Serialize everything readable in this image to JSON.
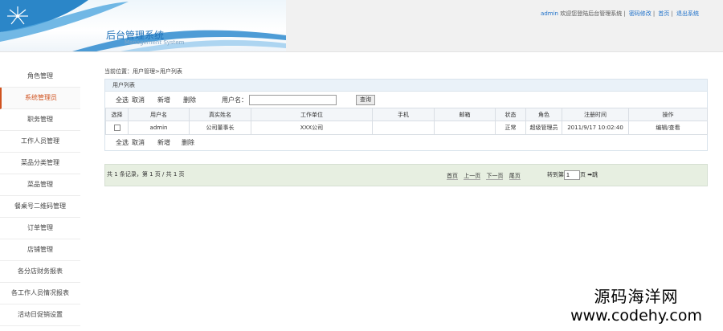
{
  "header": {
    "app_title": "后台管理系统",
    "app_subtitle": "Management System",
    "user": "admin",
    "welcome": "欢迎您登陆后台管理系统",
    "links": [
      "密码修改",
      "首页",
      "退出系统"
    ]
  },
  "sidebar": {
    "items": [
      {
        "label": "角色管理"
      },
      {
        "label": "系统管理员"
      },
      {
        "label": "职务管理"
      },
      {
        "label": "工作人员管理"
      },
      {
        "label": "菜品分类管理"
      },
      {
        "label": "菜品管理"
      },
      {
        "label": "餐桌号二维码管理"
      },
      {
        "label": "订单管理"
      },
      {
        "label": "店铺管理"
      },
      {
        "label": "各分店财务报表"
      },
      {
        "label": "各工作人员情况报表"
      },
      {
        "label": "活动日促销设置"
      }
    ],
    "active_index": 1
  },
  "main": {
    "breadcrumb": "当前位置：用户管理>用户列表",
    "panel_title": "用户列表",
    "toolbar": {
      "select_all": "全选",
      "cancel": "取消",
      "add": "新增",
      "delete": "删除",
      "username_label": "用户名：",
      "username_value": "",
      "query": "查询"
    },
    "table": {
      "headers": [
        "选择",
        "用户名",
        "真实姓名",
        "工作单位",
        "手机",
        "邮箱",
        "状态",
        "角色",
        "注册时间",
        "操作"
      ],
      "rows": [
        {
          "username": "admin",
          "realname": "公司董事长",
          "company": "XXX公司",
          "phone": "",
          "email": "",
          "status": "正常",
          "role": "超级管理员",
          "registered": "2011/9/17 10:02:40",
          "action": "编辑/查看"
        }
      ]
    },
    "pager": {
      "info": "共 1 条记录，第 1 页 / 共 1 页",
      "first": "首页",
      "prev": "上一页",
      "next": "下一页",
      "last": "尾页",
      "jump_label": "转到第",
      "jump_value": "1",
      "page_unit": "页",
      "go": "➡跳"
    }
  },
  "watermark": {
    "cn": "源码海洋网",
    "url": "www.codehy.com"
  },
  "colors": {
    "accent": "#1d6fb8",
    "active": "#d0521f",
    "panel_head": "#eaf2f9",
    "pager_bg": "#e7efe1"
  }
}
